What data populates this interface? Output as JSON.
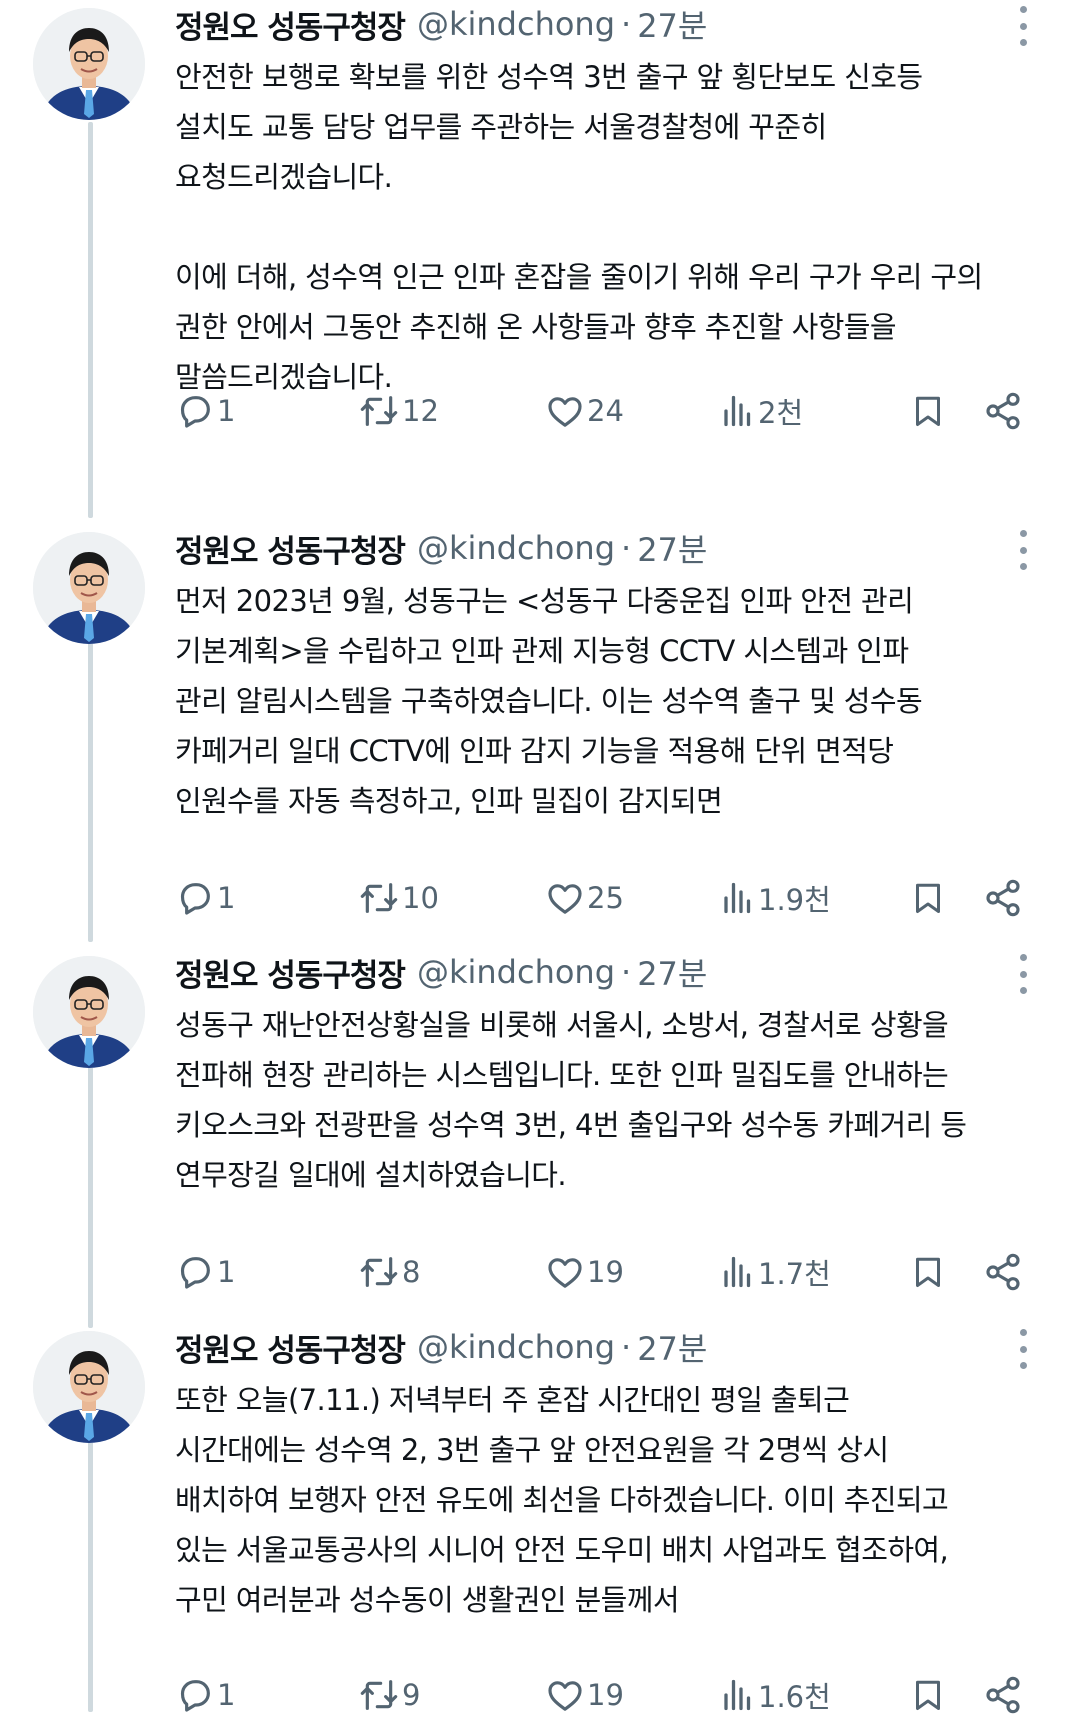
{
  "tweets": [
    {
      "author_name": "정원오 성동구청장",
      "handle": "@kindchong",
      "separator": "·",
      "time": "27분",
      "lines": [
        "안전한 보행로 확보를 위한 성수역 3번 출구 앞 횡단보도 신호등",
        "설치도 교통 담당 업무를 주관하는 서울경찰청에 꾸준히",
        "요청드리겠습니다.",
        "",
        "이에 더해, 성수역 인근 인파 혼잡을 줄이기 위해 우리 구가 우리 구의",
        "권한 안에서 그동안 추진해 온 사항들과 향후 추진할 사항들을",
        "말씀드리겠습니다."
      ],
      "stats": {
        "replies": "1",
        "retweets": "12",
        "likes": "24",
        "views": "2천"
      }
    },
    {
      "author_name": "정원오 성동구청장",
      "handle": "@kindchong",
      "separator": "·",
      "time": "27분",
      "lines": [
        "먼저 2023년 9월, 성동구는 <성동구 다중운집 인파 안전 관리",
        "기본계획>을 수립하고 인파 관제 지능형 CCTV 시스템과 인파",
        "관리 알림시스템을 구축하였습니다. 이는 성수역 출구 및 성수동",
        "카페거리 일대 CCTV에 인파 감지 기능을 적용해 단위 면적당",
        "인원수를 자동 측정하고, 인파 밀집이 감지되면"
      ],
      "stats": {
        "replies": "1",
        "retweets": "10",
        "likes": "25",
        "views": "1.9천"
      }
    },
    {
      "author_name": "정원오 성동구청장",
      "handle": "@kindchong",
      "separator": "·",
      "time": "27분",
      "lines": [
        "성동구 재난안전상황실을 비롯해 서울시, 소방서, 경찰서로 상황을",
        "전파해 현장 관리하는 시스템입니다. 또한 인파 밀집도를 안내하는",
        "키오스크와 전광판을 성수역 3번, 4번 출입구와 성수동 카페거리 등",
        "연무장길 일대에 설치하였습니다."
      ],
      "stats": {
        "replies": "1",
        "retweets": "8",
        "likes": "19",
        "views": "1.7천"
      }
    },
    {
      "author_name": "정원오 성동구청장",
      "handle": "@kindchong",
      "separator": "·",
      "time": "27분",
      "lines": [
        "또한 오늘(7.11.) 저녁부터 주 혼잡 시간대인 평일 출퇴근",
        "시간대에는 성수역 2, 3번 출구 앞 안전요원을 각 2명씩 상시",
        "배치하여 보행자 안전 유도에 최선을 다하겠습니다. 이미 추진되고",
        "있는 서울교통공사의 시니어 안전 도우미 배치 사업과도 협조하여,",
        "구민 여러분과 성수동이 생활권인 분들께서"
      ],
      "stats": {
        "replies": "1",
        "retweets": "9",
        "likes": "19",
        "views": "1.6천"
      }
    }
  ],
  "icons": {
    "reply": "reply-icon",
    "retweet": "retweet-icon",
    "like": "heart-icon",
    "views": "views-chart-icon",
    "bookmark": "bookmark-icon",
    "share": "share-icon",
    "more": "more-vertical-icon"
  },
  "colors": {
    "text": "#0f1419",
    "secondary": "#536471",
    "thread_line": "#cfd9de",
    "background": "#ffffff"
  }
}
